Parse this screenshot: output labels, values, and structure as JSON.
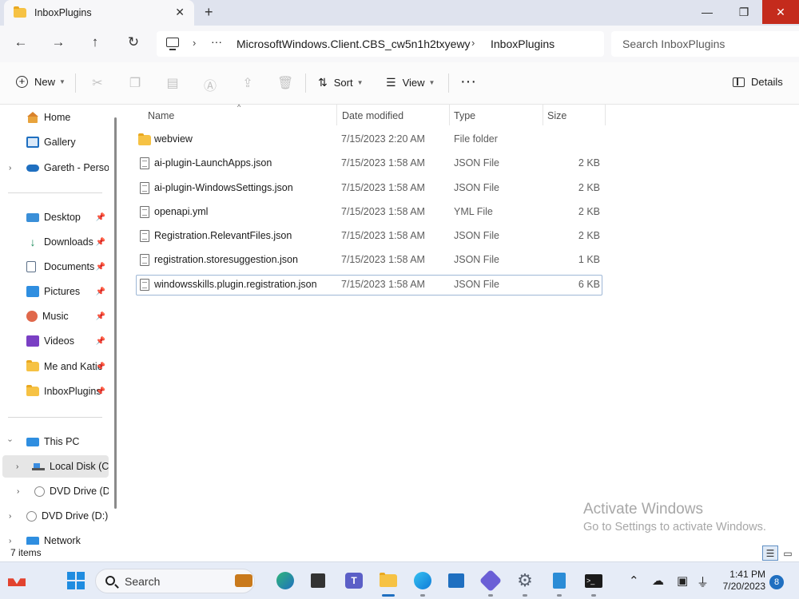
{
  "window": {
    "tab_title": "InboxPlugins",
    "tab_close": "✕",
    "new_tab": "+",
    "minimize": "—",
    "restore": "❐",
    "close": "✕"
  },
  "address": {
    "ellipsis": "···",
    "sep": "›",
    "crumbs": [
      "MicrosoftWindows.Client.CBS_cw5n1h2txyewy",
      "InboxPlugins"
    ],
    "search_placeholder": "Search InboxPlugins"
  },
  "toolbar": {
    "new_label": "New",
    "sort_label": "Sort",
    "view_label": "View",
    "more": "···",
    "details_label": "Details"
  },
  "sidebar": {
    "quick": [
      {
        "label": "Home",
        "icon": "home-icon"
      },
      {
        "label": "Gallery",
        "icon": "gallery-icon"
      },
      {
        "label": "Gareth - Personal",
        "icon": "onedrive-icon"
      }
    ],
    "pinned": [
      {
        "label": "Desktop",
        "icon": "desktop-icon"
      },
      {
        "label": "Downloads",
        "icon": "downloads-icon"
      },
      {
        "label": "Documents",
        "icon": "documents-icon"
      },
      {
        "label": "Pictures",
        "icon": "pictures-icon"
      },
      {
        "label": "Music",
        "icon": "music-icon"
      },
      {
        "label": "Videos",
        "icon": "videos-icon"
      },
      {
        "label": "Me and Katie",
        "icon": "folder-icon"
      },
      {
        "label": "InboxPlugins",
        "icon": "folder-icon"
      }
    ],
    "drives": [
      {
        "label": "This PC",
        "icon": "pc-icon"
      },
      {
        "label": "Local Disk (C:)",
        "icon": "drive-icon"
      },
      {
        "label": "DVD Drive (D:)",
        "icon": "dvd-icon"
      },
      {
        "label": "DVD Drive (D:) V",
        "icon": "dvd-icon"
      },
      {
        "label": "Network",
        "icon": "network-icon"
      }
    ]
  },
  "columns": {
    "name": "Name",
    "date": "Date modified",
    "type": "Type",
    "size": "Size"
  },
  "files": [
    {
      "name": "webview",
      "date": "7/15/2023 2:20 AM",
      "type": "File folder",
      "size": "",
      "icon": "folder-icon"
    },
    {
      "name": "ai-plugin-LaunchApps.json",
      "date": "7/15/2023 1:58 AM",
      "type": "JSON File",
      "size": "2 KB",
      "icon": "file-icon"
    },
    {
      "name": "ai-plugin-WindowsSettings.json",
      "date": "7/15/2023 1:58 AM",
      "type": "JSON File",
      "size": "2 KB",
      "icon": "file-icon"
    },
    {
      "name": "openapi.yml",
      "date": "7/15/2023 1:58 AM",
      "type": "YML File",
      "size": "2 KB",
      "icon": "file-icon"
    },
    {
      "name": "Registration.RelevantFiles.json",
      "date": "7/15/2023 1:58 AM",
      "type": "JSON File",
      "size": "2 KB",
      "icon": "file-icon"
    },
    {
      "name": "registration.storesuggestion.json",
      "date": "7/15/2023 1:58 AM",
      "type": "JSON File",
      "size": "1 KB",
      "icon": "file-icon"
    },
    {
      "name": "windowsskills.plugin.registration.json",
      "date": "7/15/2023 1:58 AM",
      "type": "JSON File",
      "size": "6 KB",
      "icon": "file-icon"
    }
  ],
  "watermark": {
    "line1": "Activate Windows",
    "line2": "Go to Settings to activate Windows."
  },
  "status": {
    "item_count": "7 items"
  },
  "taskbar": {
    "search_label": "Search",
    "time": "1:41 PM",
    "date": "7/20/2023",
    "notifications": "8"
  },
  "colors": {
    "accent": "#1f6fc0",
    "close_button": "#c42b1c",
    "folder": "#f6c244"
  }
}
